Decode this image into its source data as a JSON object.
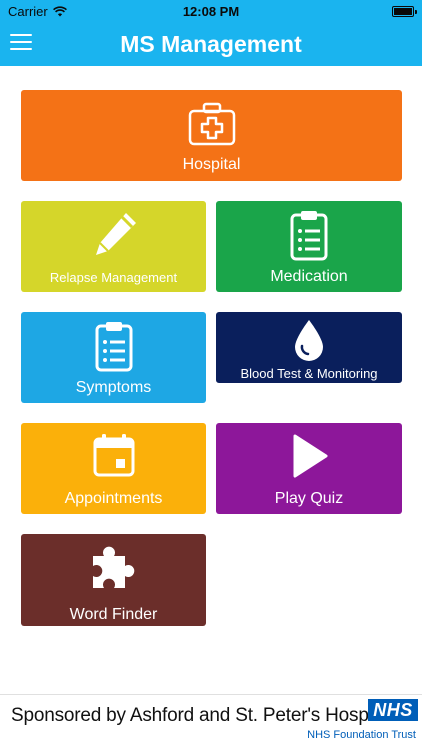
{
  "status_bar": {
    "carrier": "Carrier",
    "time": "12:08 PM"
  },
  "nav": {
    "title": "MS Management"
  },
  "tiles": [
    {
      "label": "Hospital",
      "color": "#f47216",
      "icon": "first-aid-kit-icon"
    },
    {
      "label": "Relapse Management",
      "color": "#d5d62a",
      "icon": "pencil-icon"
    },
    {
      "label": "Medication",
      "color": "#1aa54a",
      "icon": "clipboard-icon"
    },
    {
      "label": "Symptoms",
      "color": "#1ea7e4",
      "icon": "clipboard-icon"
    },
    {
      "label": "Blood Test & Monitoring",
      "color": "#0a1f5c",
      "icon": "blood-drop-icon"
    },
    {
      "label": "Appointments",
      "color": "#fbb00a",
      "icon": "calendar-icon"
    },
    {
      "label": "Play Quiz",
      "color": "#8d179a",
      "icon": "play-icon"
    },
    {
      "label": "Word Finder",
      "color": "#6b2e2a",
      "icon": "puzzle-icon"
    }
  ],
  "footer": {
    "sponsor": "Sponsored by Ashford and St. Peter's Hospitals",
    "nhs": "NHS",
    "trust": "NHS Foundation Trust",
    "nhs_color": "#005eb8"
  }
}
